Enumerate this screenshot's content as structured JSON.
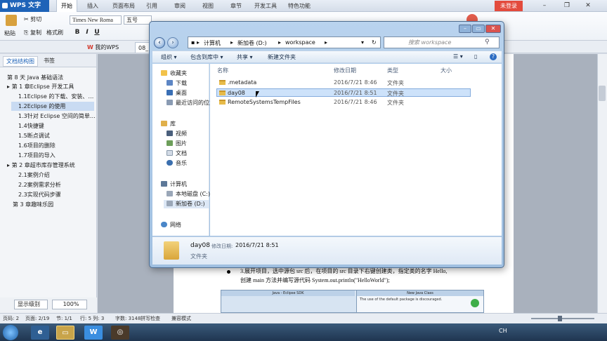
{
  "wps": {
    "app_title": "WPS 文字",
    "menus": [
      "开始",
      "插入",
      "页面布局",
      "引用",
      "审阅",
      "视图",
      "章节",
      "开发工具",
      "特色功能"
    ],
    "login": "未登录",
    "ribbon": {
      "paste": "粘贴",
      "cut": "剪切",
      "copy": "复制",
      "format_painter": "格式刷",
      "font_name": "Times New Roma",
      "font_size": "五号",
      "bold": "B",
      "italic": "I",
      "underline": "U"
    },
    "tabs": {
      "my_wps": "我的WPS",
      "doc": "08_"
    }
  },
  "nav_pane": {
    "tabs": [
      "文档结构图",
      "书签"
    ],
    "items": [
      "第 8 天 Java 基础语法",
      "第 1 章Eclipse 开发工具",
      "1.1Eclipse 的下载、安装、…",
      "1.2Eclipse 的使用",
      "1.3针对 Eclipse 空间的简单…",
      "1.4快捷键",
      "1.5断点调试",
      "1.6项目的删除",
      "1.7项目的导入",
      "第 2 章超市库存管理系统",
      "2.1案例介绍",
      "2.2案例需求分析",
      "2.3实现代码步骤",
      "第 3 章趣味乐园"
    ],
    "selected_index": 3,
    "display_level": "显示级别",
    "zoom": "100%"
  },
  "document": {
    "line1": "3.展开项目，选中源包 src 后，在项目的 src 目录下右键创建类，指定类的名字 Hello,",
    "line2": "创建 main 方法并编写源代码 System.out.println(\"HelloWorld\");",
    "embedded_title": "Java - Eclipse SDK",
    "embedded_title2": "New Java Class",
    "embedded_msg": "The use of the default package is discouraged."
  },
  "status_bar": {
    "page": "页码: 2",
    "pages": "页面: 2/19",
    "section": "节: 1/1",
    "row_col": "行: 5  列: 3",
    "word_count": "字数: 3148",
    "spell": "拼写检查",
    "compat": "兼容模式"
  },
  "explorer": {
    "breadcrumb": [
      "计算机",
      "新加卷 (D:)",
      "workspace"
    ],
    "search_placeholder": "搜索 workspace",
    "toolbar": [
      "组织",
      "包含到库中",
      "共享",
      "新建文件夹"
    ],
    "sidebar": {
      "favorites": "收藏夹",
      "favorites_items": [
        "下载",
        "桌面",
        "最近访问的位置"
      ],
      "libraries": "库",
      "library_items": [
        "视频",
        "图片",
        "文档",
        "音乐"
      ],
      "computer": "计算机",
      "computer_items": [
        "本地磁盘 (C:)",
        "新加卷 (D:)"
      ],
      "network": "网络"
    },
    "columns": [
      "名称",
      "修改日期",
      "类型",
      "大小"
    ],
    "rows": [
      {
        "name": ".metadata",
        "date": "2016/7/21 8:46",
        "type": "文件夹"
      },
      {
        "name": "day08",
        "date": "2016/7/21 8:51",
        "type": "文件夹"
      },
      {
        "name": "RemoteSystemsTempFiles",
        "date": "2016/7/21 8:46",
        "type": "文件夹"
      }
    ],
    "selected_row": 1,
    "details": {
      "name": "day08",
      "modified_label": "修改日期:",
      "modified_value": "2016/7/21 8:51",
      "type": "文件夹"
    }
  },
  "taskbar": {
    "tray_text": "CH",
    "wps_letter": "W"
  }
}
